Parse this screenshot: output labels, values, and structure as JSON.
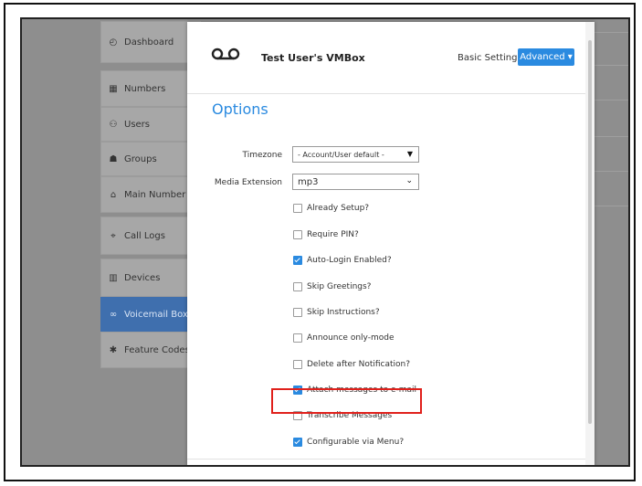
{
  "sidebar": {
    "items": [
      {
        "label": "Dashboard",
        "icon": "dashboard-icon"
      },
      {
        "label": "Numbers",
        "icon": "grid-icon"
      },
      {
        "label": "Users",
        "icon": "users-icon"
      },
      {
        "label": "Groups",
        "icon": "groups-icon"
      },
      {
        "label": "Main Number",
        "icon": "home-icon"
      },
      {
        "label": "Call Logs",
        "icon": "call-logs-icon"
      },
      {
        "label": "Devices",
        "icon": "devices-icon"
      },
      {
        "label": "Voicemail Boxes",
        "icon": "voicemail-icon",
        "active": true
      },
      {
        "label": "Feature Codes",
        "icon": "asterisk-icon"
      }
    ]
  },
  "modal": {
    "title": "Test User's VMBox",
    "basic_settings_label": "Basic Settings",
    "advanced_label": "Advanced ▾",
    "section_title": "Options",
    "timezone": {
      "label": "Timezone",
      "value": "- Account/User default -"
    },
    "media_extension": {
      "label": "Media Extension",
      "value": "mp3"
    },
    "options": [
      {
        "label": "Already Setup?",
        "checked": false
      },
      {
        "label": "Require PIN?",
        "checked": false
      },
      {
        "label": "Auto-Login Enabled?",
        "checked": true
      },
      {
        "label": "Skip Greetings?",
        "checked": false
      },
      {
        "label": "Skip Instructions?",
        "checked": false
      },
      {
        "label": "Announce only-mode",
        "checked": false
      },
      {
        "label": "Delete after Notification?",
        "checked": false
      },
      {
        "label": "Attach messages to e-mail",
        "checked": true
      },
      {
        "label": "Transcribe Messages",
        "checked": false,
        "highlighted": true
      },
      {
        "label": "Configurable via Menu?",
        "checked": true
      }
    ]
  },
  "colors": {
    "accent": "#2a8ae0",
    "highlight": "#e0201b",
    "sidebar_active": "#3f6fae"
  }
}
